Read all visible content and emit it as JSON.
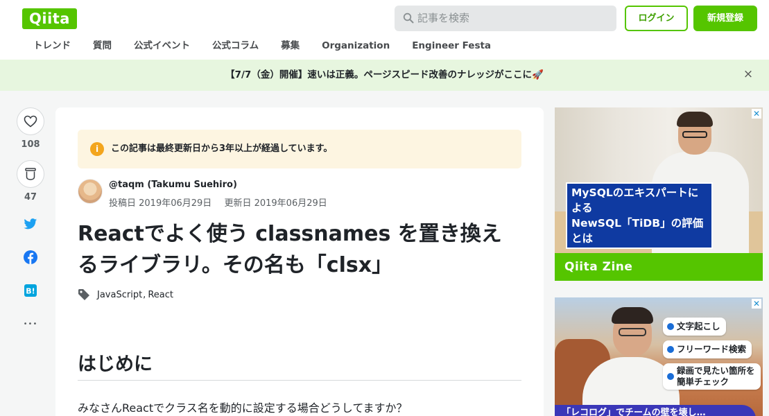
{
  "header": {
    "logo": "Qiita",
    "search_placeholder": "記事を検索",
    "login_label": "ログイン",
    "signup_label": "新規登録",
    "nav": [
      "トレンド",
      "質問",
      "公式イベント",
      "公式コラム",
      "募集",
      "Organization",
      "Engineer Festa"
    ]
  },
  "banner": {
    "text": "【7/7（金）開催】速いは正義。ページスピード改善のナレッジがここに🚀",
    "close": "×"
  },
  "rail": {
    "like_count": "108",
    "stock_count": "47",
    "more": "•••"
  },
  "article": {
    "notice": "この記事は最終更新日から3年以上が経過しています。",
    "notice_icon": "i",
    "author": "@taqm (Takumu Suehiro)",
    "posted": "投稿日 2019年06月29日",
    "updated": "更新日 2019年06月29日",
    "title": "Reactでよく使う classnames を置き換えるライブラリ。その名も「clsx」",
    "tags": [
      "JavaScript",
      "React"
    ],
    "tag_separator": ",",
    "heading": "はじめに",
    "paragraph": "みなさんReactでクラス名を動的に設定する場合どうしてますか？"
  },
  "ads": {
    "ad1_label_line1": "MySQLのエキスパートによる",
    "ad1_label_line2": "NewSQL「TiDB」の評価とは",
    "ad1_footer": "Qiita Zine",
    "ad2_pill1": "文字起こし",
    "ad2_pill2": "フリーワード検索",
    "ad2_pill3_line1": "録画で見たい箇所を",
    "ad2_pill3_line2": "簡単チェック",
    "ad2_bottom": "「レコログ」でチームの壁を壊し…",
    "close": "✕"
  },
  "colors": {
    "brand": "#55c500",
    "banner_bg": "#e7f6df",
    "notice_bg": "#fdf5e1",
    "twitter": "#1da1f2",
    "facebook": "#1877f2",
    "hatena": "#00a4de"
  },
  "icons": [
    "search-icon",
    "heart-icon",
    "stock-icon",
    "twitter-icon",
    "facebook-icon",
    "hatena-bookmark-icon",
    "more-icon",
    "tag-icon",
    "info-icon",
    "close-icon"
  ]
}
